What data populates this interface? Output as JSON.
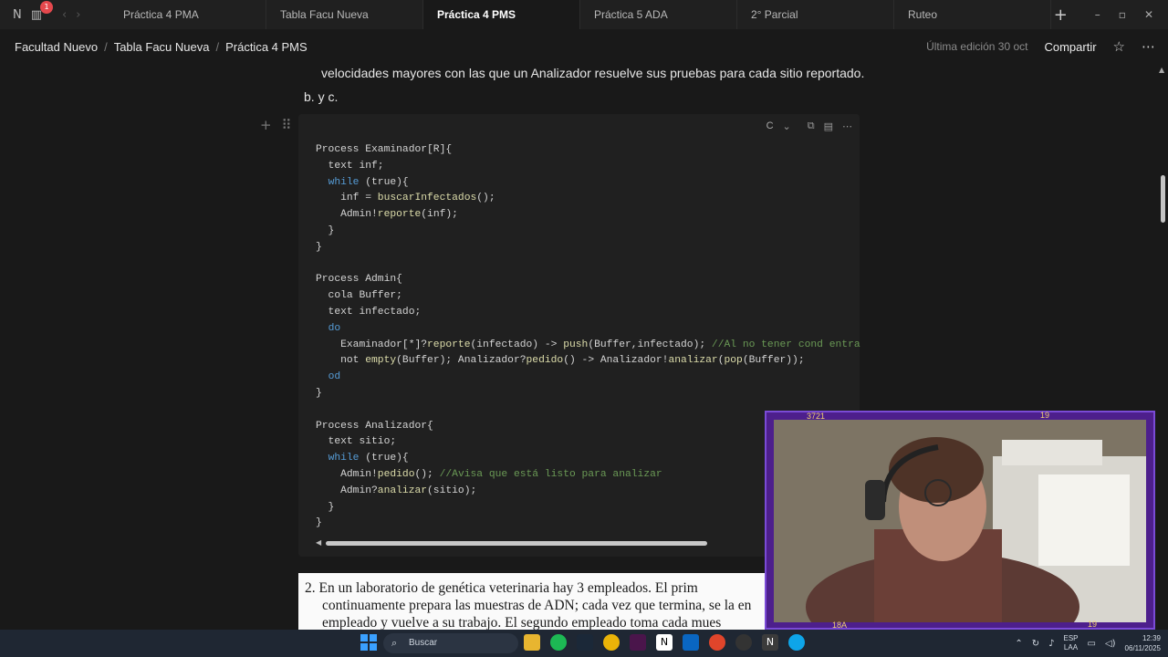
{
  "tabs": [
    {
      "label": "Práctica 4 PMA",
      "active": false
    },
    {
      "label": "Tabla Facu Nueva",
      "active": false
    },
    {
      "label": "Práctica 4 PMS",
      "active": true
    },
    {
      "label": "Práctica 5 ADA",
      "active": false
    },
    {
      "label": "2° Parcial",
      "active": false
    },
    {
      "label": "Ruteo",
      "active": false
    }
  ],
  "notification_count": "1",
  "breadcrumb": [
    "Facultad Nuevo",
    "Tabla Facu Nueva",
    "Práctica 4 PMS"
  ],
  "last_edit": "Última edición 30 oct",
  "share_label": "Compartir",
  "paragraph_tail": "velocidades mayores con las que un Analizador resuelve sus pruebas para cada sitio reportado.",
  "sub_heading": "b.  y  c.",
  "code_language": "C",
  "code_lines": [
    "Process Examinador[R]{",
    "  text inf;",
    "  while (true){",
    "    inf = buscarInfectados();",
    "    Admin!reporte(inf);",
    "  }",
    "}",
    "",
    "Process Admin{",
    "  cola Buffer;",
    "  text infectado;",
    "  do",
    "    Examinador[*]?reporte(infectado) -> push(Buffer,infectado); //Al no tener cond entra",
    "    not empty(Buffer); Analizador?pedido() -> Analizador!analizar(pop(Buffer));",
    "  od",
    "}",
    "",
    "Process Analizador{",
    "  text sitio;",
    "  while (true){",
    "    Admin!pedido(); //Avisa que está listo para analizar",
    "    Admin?analizar(sitio);",
    "  }",
    "}"
  ],
  "paper_lines": [
    "2. En un laboratorio de genética veterinaria hay 3 empleados. El prim",
    "continuamente prepara las muestras de ADN; cada vez que termina, se la en",
    "empleado y vuelve a su trabajo. El segundo empleado toma cada mues"
  ],
  "webcam_labels": {
    "top_left": "3721",
    "top_right": "19",
    "bottom_left": "18A",
    "bottom_right": "19"
  },
  "taskbar": {
    "search_placeholder": "Buscar",
    "language_top": "ESP",
    "language_bottom": "LAA",
    "time": "12:39",
    "date": "06/11/2025"
  },
  "colors": {
    "keyword": "#569cd6",
    "function": "#dcdcaa",
    "comment": "#6a9955",
    "webcam_frame": "#4d1f8c"
  }
}
